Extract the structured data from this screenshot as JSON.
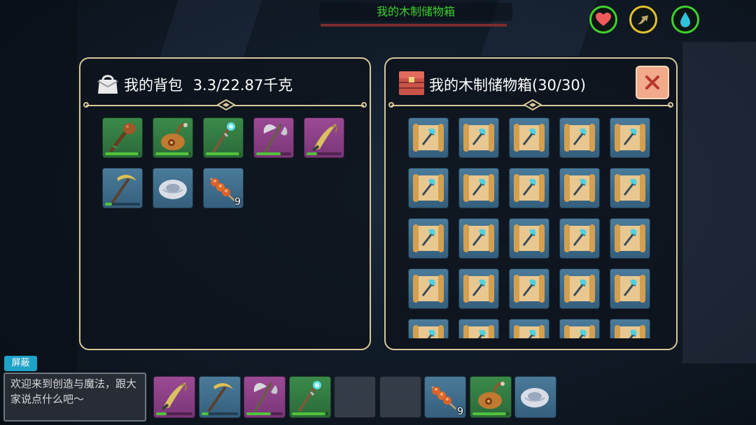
{
  "top": {
    "title": "我的木制储物箱"
  },
  "status": [
    {
      "name": "health",
      "icon": "heart-icon",
      "color": "#3fd22a"
    },
    {
      "name": "stamina",
      "icon": "stamina-icon",
      "color": "#e5c12a"
    },
    {
      "name": "thirst",
      "icon": "water-drop-icon",
      "color": "#3fd22a"
    }
  ],
  "bag": {
    "title": "我的背包",
    "weight": "3.3/22.87千克",
    "items": [
      {
        "icon": "wooden-club-icon",
        "rarity": "green",
        "durability": 0.95
      },
      {
        "icon": "water-gourd-icon",
        "rarity": "green",
        "durability": 0.95
      },
      {
        "icon": "magic-staff-icon",
        "rarity": "green",
        "durability": 0.95
      },
      {
        "icon": "battle-axe-icon",
        "rarity": "purple",
        "durability": 0.7
      },
      {
        "icon": "scythe-blade-icon",
        "rarity": "purple",
        "durability": 0.3
      },
      {
        "icon": "pickaxe-icon",
        "rarity": "blue",
        "durability": 0.2
      },
      {
        "icon": "shell-stone-icon",
        "rarity": "blue",
        "durability": null
      },
      {
        "icon": "meat-skewer-icon",
        "rarity": "blue",
        "durability": null,
        "count": "9"
      }
    ]
  },
  "chest": {
    "title": "我的木制储物箱(30/30)",
    "slot_count": 30,
    "slot_icon": "blueprint-scroll-icon"
  },
  "chat": {
    "shield_label": "屏蔽",
    "message": "欢迎来到创造与魔法，跟大家说点什么吧～"
  },
  "hotbar": [
    {
      "icon": "scythe-blade-icon",
      "rarity": "purple",
      "durability": 0.3
    },
    {
      "icon": "pickaxe-icon",
      "rarity": "blue",
      "durability": 0.2
    },
    {
      "icon": "battle-axe-icon",
      "rarity": "purple",
      "durability": 0.7
    },
    {
      "icon": "magic-staff-icon",
      "rarity": "green",
      "durability": 0.95
    },
    {
      "icon": "empty-slot",
      "rarity": "empty",
      "durability": null
    },
    {
      "icon": "empty-slot",
      "rarity": "empty",
      "durability": null
    },
    {
      "icon": "meat-skewer-icon",
      "rarity": "blue",
      "durability": null,
      "count": "9"
    },
    {
      "icon": "water-gourd-icon",
      "rarity": "green",
      "durability": 0.95
    },
    {
      "icon": "shell-stone-icon",
      "rarity": "blue",
      "durability": null
    }
  ]
}
